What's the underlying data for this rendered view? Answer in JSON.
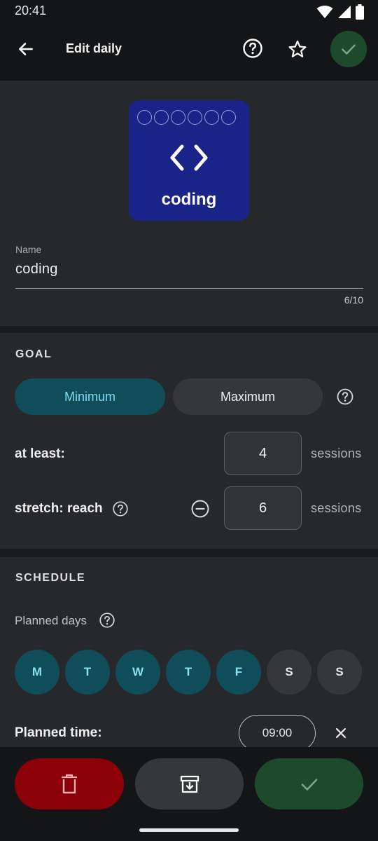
{
  "status_bar": {
    "time": "20:41",
    "icons": [
      "wifi-icon",
      "signal-icon",
      "battery-icon"
    ]
  },
  "app_bar": {
    "title": "Edit daily"
  },
  "habit": {
    "name": "coding",
    "tile_color": "#1a2387",
    "icon": "code-brackets-icon",
    "progress_dots_total": 6
  },
  "name_field": {
    "label": "Name",
    "value": "coding",
    "counter": "6/10"
  },
  "goal": {
    "title": "GOAL",
    "mode_options": [
      "Minimum",
      "Maximum"
    ],
    "selected_mode": "Minimum",
    "at_least": {
      "label": "at least:",
      "value": "4",
      "unit": "sessions"
    },
    "stretch": {
      "label": "stretch: reach",
      "value": "6",
      "unit": "sessions"
    }
  },
  "schedule": {
    "title": "SCHEDULE",
    "planned_days_label": "Planned days",
    "days": [
      {
        "label": "M",
        "selected": true
      },
      {
        "label": "T",
        "selected": true
      },
      {
        "label": "W",
        "selected": true
      },
      {
        "label": "T",
        "selected": true
      },
      {
        "label": "F",
        "selected": true
      },
      {
        "label": "S",
        "selected": false
      },
      {
        "label": "S",
        "selected": false
      }
    ],
    "planned_time_label": "Planned time:",
    "planned_time_value": "09:00"
  },
  "colors": {
    "accent_teal": "#0f4d58",
    "confirm_green": "#1e4a2c",
    "delete_red": "#8c0007"
  }
}
